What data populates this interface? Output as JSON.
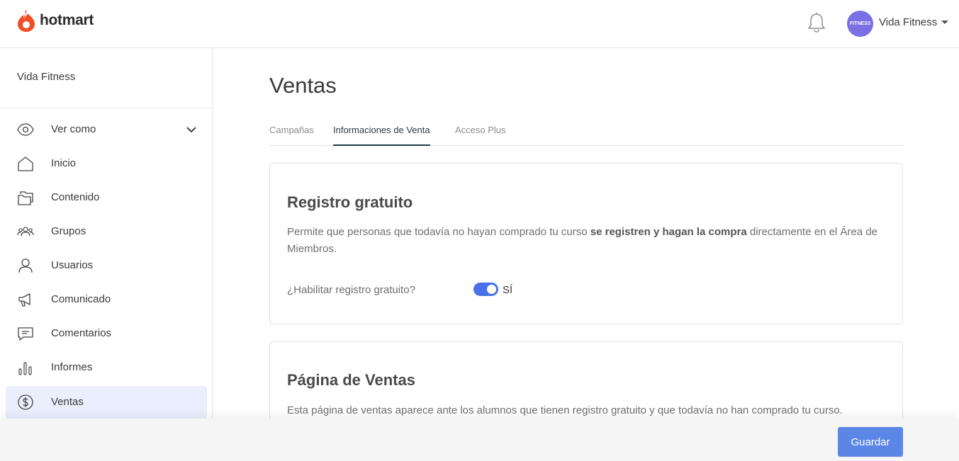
{
  "header": {
    "logo_text": "hotmart",
    "user_name": "Vida Fitness",
    "avatar_text": "FITNESS",
    "brand_color": "#f04e23"
  },
  "sidebar": {
    "title": "Vida Fitness",
    "items": [
      {
        "label": "Ver como",
        "icon": "eye-icon"
      },
      {
        "label": "Inicio",
        "icon": "home-icon"
      },
      {
        "label": "Contenido",
        "icon": "folders-icon"
      },
      {
        "label": "Grupos",
        "icon": "group-icon"
      },
      {
        "label": "Usuarios",
        "icon": "user-icon"
      },
      {
        "label": "Comunicado",
        "icon": "megaphone-icon"
      },
      {
        "label": "Comentarios",
        "icon": "comment-icon"
      },
      {
        "label": "Informes",
        "icon": "bar-chart-icon"
      },
      {
        "label": "Ventas",
        "icon": "dollar-icon",
        "active": true
      }
    ]
  },
  "main": {
    "title": "Ventas",
    "tabs": [
      {
        "label": "Campañas"
      },
      {
        "label": "Informaciones de Venta",
        "active": true
      },
      {
        "label": "Acceso Plus"
      }
    ],
    "registro": {
      "title": "Registro gratuito",
      "desc_1": "Permite que personas que todavía no hayan comprado tu curso ",
      "desc_bold": "se registren y hagan la compra",
      "desc_2": " directamente en el Área de Miembros.",
      "toggle_label": "¿Habilitar registro gratuito?",
      "toggle_state": "SÍ",
      "toggle_on": true
    },
    "pagina": {
      "title": "Página de Ventas",
      "desc": "Esta página de ventas aparece ante los alumnos que tienen registro gratuito y que todavía no han comprado tu curso."
    }
  },
  "footer": {
    "save_label": "Guardar"
  },
  "colors": {
    "accent": "#5b86e5",
    "toggle": "#4a72e8",
    "active_nav_bg": "#ebeefc"
  }
}
